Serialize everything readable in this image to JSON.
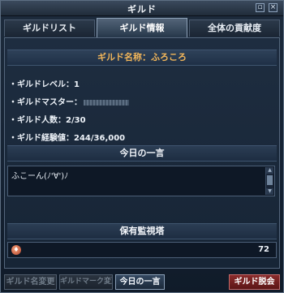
{
  "window": {
    "title": "ギルド"
  },
  "tabs": [
    {
      "label": "ギルドリスト",
      "active": false
    },
    {
      "label": "ギルド情報",
      "active": true
    },
    {
      "label": "全体の貢献度",
      "active": false
    }
  ],
  "guild": {
    "name_label": "ギルド名称：",
    "name_value": "ふろころ",
    "level_label": "・ギルドレベル：",
    "level_value": "1",
    "master_label": "・ギルドマスター：",
    "members_label": "・ギルド人数：",
    "members_value": "2/30",
    "exp_label": "・ギルド経験値：",
    "exp_value": "244/36,000"
  },
  "message": {
    "header": "今日の一言",
    "text": "ふこーん(ﾉ'∀')ﾉ"
  },
  "tower": {
    "header": "保有監視塔",
    "count": "72"
  },
  "buttons": {
    "rename": "ギルド名変更",
    "mark_change": "ギルドマーク変更",
    "message": "今日の一言",
    "leave": "ギルド脱会"
  },
  "colors": {
    "accent_orange": "#f2b65a",
    "leave_red": "#8a2b2b"
  }
}
